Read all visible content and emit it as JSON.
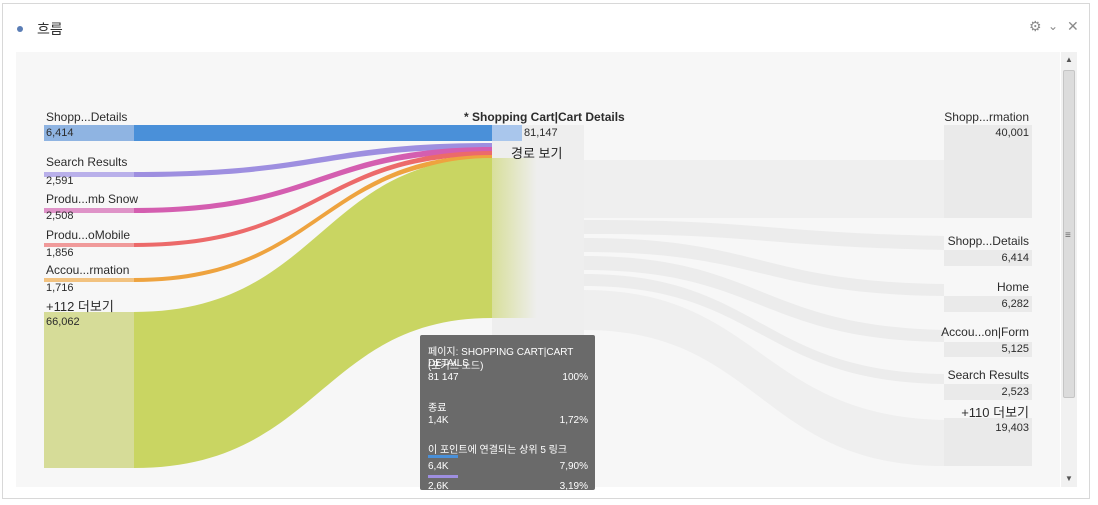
{
  "header": {
    "title": "흐름"
  },
  "center": {
    "title": "* Shopping Cart|Cart Details",
    "value": "81,147",
    "hover_label": "경로 보기"
  },
  "left_nodes": [
    {
      "label": "Shopp...Details",
      "value": "6,414"
    },
    {
      "label": "Search Results",
      "value": "2,591"
    },
    {
      "label": "Produ...mb Snow",
      "value": "2,508"
    },
    {
      "label": "Produ...oMobile",
      "value": "1,856"
    },
    {
      "label": "Accou...rmation",
      "value": "1,716"
    },
    {
      "label": "+112 더보기",
      "value": "66,062"
    }
  ],
  "right_nodes": [
    {
      "label": "Shopp...rmation",
      "value": "40,001"
    },
    {
      "label": "Shopp...Details",
      "value": "6,414"
    },
    {
      "label": "Home",
      "value": "6,282"
    },
    {
      "label": "Accou...on|Form",
      "value": "5,125"
    },
    {
      "label": "Search Results",
      "value": "2,523"
    },
    {
      "label": "+110 더보기",
      "value": "19,403"
    }
  ],
  "tooltip": {
    "title": "페이지: SHOPPING CART|CART DETAILS",
    "subtitle": "(포커스 노드)",
    "total_value": "81 147",
    "total_pct": "100%",
    "exit_label": "종료",
    "exit_value": "1,4K",
    "exit_pct": "1,72%",
    "links_label": "이 포인트에 연결되는 상위 5 링크",
    "link1_value": "6,4K",
    "link1_pct": "7,90%",
    "link2_value": "2,6K",
    "link2_pct": "3,19%"
  },
  "colors": {
    "blue": "#4a90d9",
    "purple": "#9e8fe0",
    "magenta": "#d45eb0",
    "red": "#ec6a6a",
    "orange": "#eea33f",
    "green": "#c9d562",
    "gray_bar": "#ebebeb"
  },
  "icons": [
    "gear-icon",
    "chevron-down-icon",
    "close-icon"
  ]
}
